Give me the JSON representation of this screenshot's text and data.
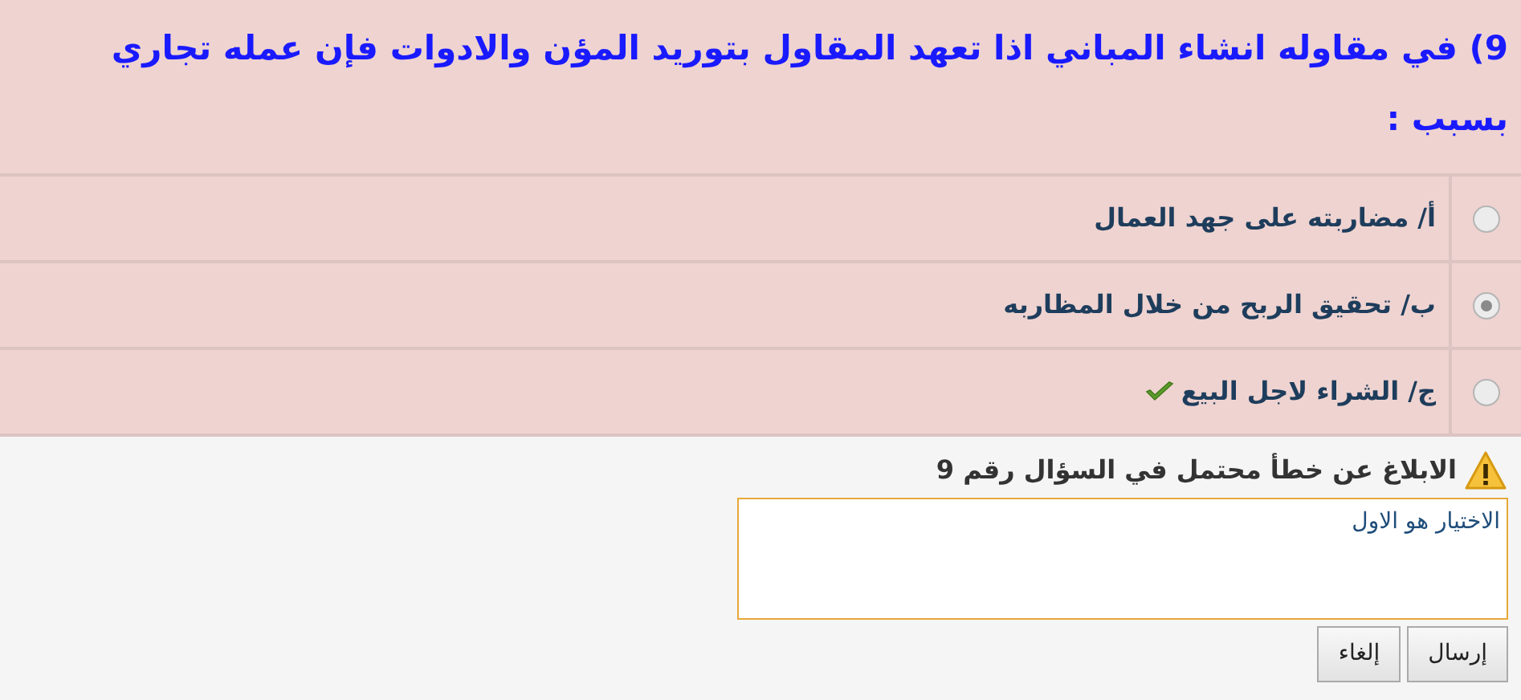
{
  "question": {
    "text": "9) في مقاوله انشاء المباني اذا تعهد المقاول بتوريد المؤن والادوات فإن عمله تجاري بسبب :"
  },
  "options": [
    {
      "label": "أ/ مضاربته على جهد العمال",
      "selected": false,
      "correct": false
    },
    {
      "label": "ب/ تحقيق الربح من خلال المظاربه",
      "selected": true,
      "correct": false
    },
    {
      "label": "ج/ الشراء لاجل البيع",
      "selected": false,
      "correct": true
    }
  ],
  "report": {
    "title": "الابلاغ عن خطأ محتمل في السؤال رقم 9",
    "value": "الاختيار هو الاول",
    "buttons": [
      "إرسال",
      "إلغاء"
    ]
  }
}
